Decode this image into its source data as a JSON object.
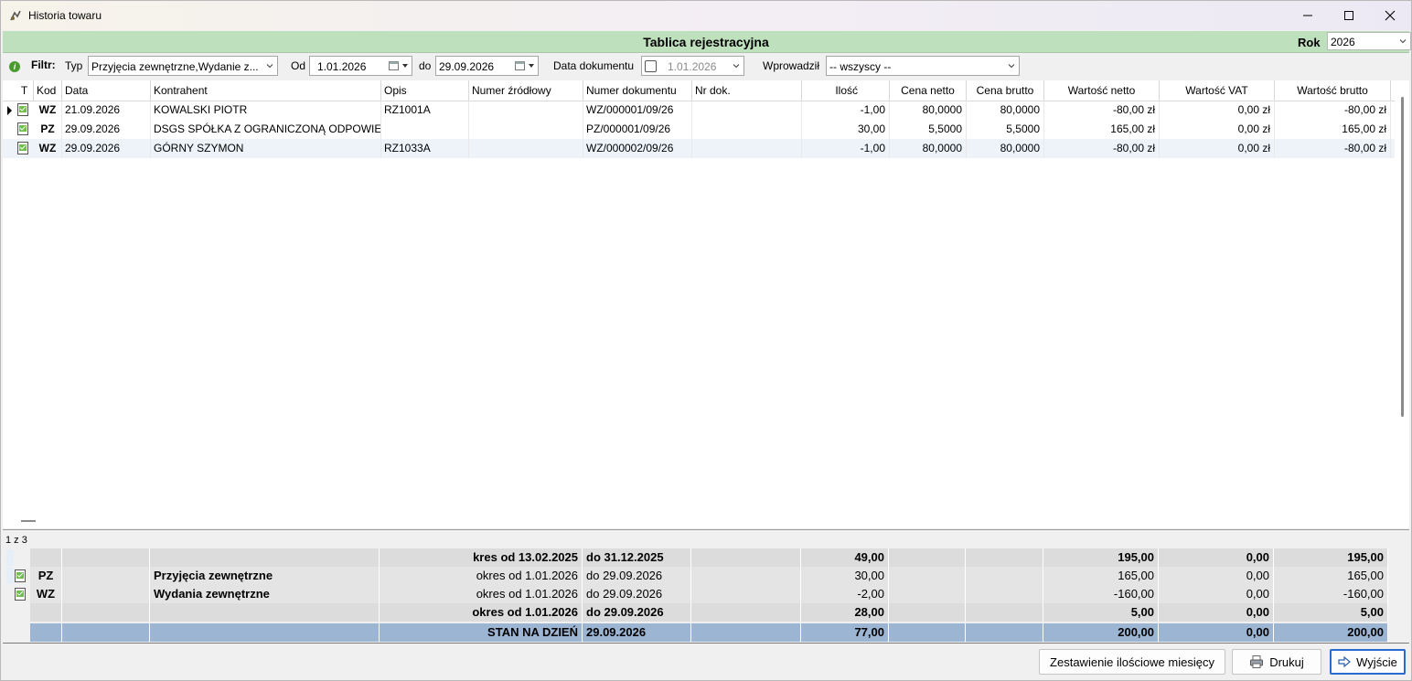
{
  "window": {
    "title": "Historia towaru"
  },
  "header": {
    "title": "Tablica rejestracyjna",
    "rok_label": "Rok",
    "rok_value": "2026"
  },
  "filter": {
    "label": "Filtr:",
    "typ_label": "Typ",
    "typ_value": "Przyjęcia zewnętrzne,Wydanie z...",
    "od_label": "Od",
    "od_value": "1.01.2026",
    "do_label": "do",
    "do_value": "29.09.2026",
    "data_dok_label": "Data dokumentu",
    "data_dok_value": "1.01.2026",
    "wprowadzil_label": "Wprowadził",
    "wprowadzil_value": "-- wszyscy --"
  },
  "table": {
    "columns": [
      "T",
      "Kod",
      "Data",
      "Kontrahent",
      "Opis",
      "Numer źródłowy",
      "Numer dokumentu",
      "Nr dok.",
      "Ilość",
      "Cena netto",
      "Cena brutto",
      "Wartość netto",
      "Wartość VAT",
      "Wartość brutto"
    ],
    "rows": [
      {
        "kod": "WZ",
        "data": "21.09.2026",
        "kontrahent": "KOWALSKI PIOTR",
        "opis": "RZ1001A",
        "numer_zrodlowy": "",
        "numer_dokumentu": "WZ/000001/09/26",
        "nr_dok": "",
        "ilosc": "-1,00",
        "cena_netto": "80,0000",
        "cena_brutto": "80,0000",
        "wartosc_netto": "-80,00 zł",
        "wartosc_vat": "0,00 zł",
        "wartosc_brutto": "-80,00 zł"
      },
      {
        "kod": "PZ",
        "data": "29.09.2026",
        "kontrahent": "DSGS SPÓŁKA Z OGRANICZONĄ ODPOWIEDZIALNOŚCIĄ",
        "opis": "",
        "numer_zrodlowy": "",
        "numer_dokumentu": "PZ/000001/09/26",
        "nr_dok": "",
        "ilosc": "30,00",
        "cena_netto": "5,5000",
        "cena_brutto": "5,5000",
        "wartosc_netto": "165,00 zł",
        "wartosc_vat": "0,00 zł",
        "wartosc_brutto": "165,00 zł"
      },
      {
        "kod": "WZ",
        "data": "29.09.2026",
        "kontrahent": "GÓRNY SZYMON",
        "opis": "RZ1033A",
        "numer_zrodlowy": "",
        "numer_dokumentu": "WZ/000002/09/26",
        "nr_dok": "",
        "ilosc": "-1,00",
        "cena_netto": "80,0000",
        "cena_brutto": "80,0000",
        "wartosc_netto": "-80,00 zł",
        "wartosc_vat": "0,00 zł",
        "wartosc_brutto": "-80,00 zł"
      }
    ],
    "record_count": "1 z 3"
  },
  "summary": [
    {
      "kod": "",
      "name": "",
      "okres": "kres od 13.02.2025",
      "do": "do 31.12.2025",
      "ilosc": "49,00",
      "netto": "195,00",
      "vat": "0,00",
      "brutto": "195,00"
    },
    {
      "kod": "PZ",
      "name": "Przyjęcia zewnętrzne",
      "okres": "okres od 1.01.2026",
      "do": "do 29.09.2026",
      "ilosc": "30,00",
      "netto": "165,00",
      "vat": "0,00",
      "brutto": "165,00"
    },
    {
      "kod": "WZ",
      "name": "Wydania zewnętrzne",
      "okres": "okres od 1.01.2026",
      "do": "do 29.09.2026",
      "ilosc": "-2,00",
      "netto": "-160,00",
      "vat": "0,00",
      "brutto": "-160,00"
    },
    {
      "kod": "",
      "name": "",
      "okres": "okres od 1.01.2026",
      "do": "do 29.09.2026",
      "ilosc": "28,00",
      "netto": "5,00",
      "vat": "0,00",
      "brutto": "5,00"
    },
    {
      "kod": "",
      "name": "",
      "okres": "STAN NA DZIEŃ",
      "do": "29.09.2026",
      "ilosc": "77,00",
      "netto": "200,00",
      "vat": "0,00",
      "brutto": "200,00"
    }
  ],
  "buttons": {
    "zestawienie": "Zestawienie ilościowe miesięcy",
    "drukuj": "Drukuj",
    "wyjscie": "Wyjście"
  }
}
